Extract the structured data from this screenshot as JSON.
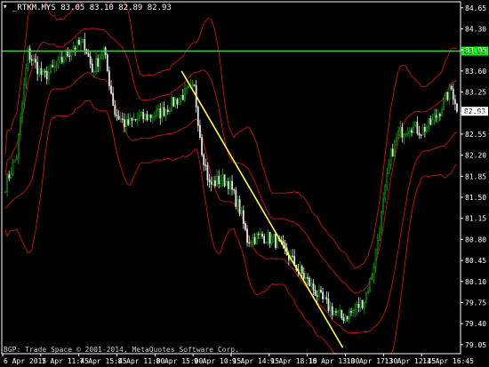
{
  "title": {
    "symbol": "_RTKM.MYS",
    "ohlc": "83.05 83.10 82.89 82.93"
  },
  "copyright": "BGP: Trade Space © 2001-2014, MetaQuotes Software Corp.",
  "colors": {
    "background": "#000000",
    "axis": "#ffffff",
    "bull": "#00b000",
    "bear": "#e8e8e8",
    "bands": "#d01010",
    "level_line": "#00ff00",
    "trend_line": "#ffff40",
    "grid": "#404040"
  },
  "chart_data": {
    "type": "candlestick",
    "ylim": [
      78.9,
      84.75
    ],
    "y_ticks": [
      "84.65",
      "84.30",
      "83.95",
      "83.60",
      "83.25",
      "82.90",
      "82.55",
      "82.20",
      "81.85",
      "81.50",
      "81.15",
      "80.80",
      "80.45",
      "80.10",
      "79.75",
      "79.40",
      "79.05"
    ],
    "x_ticks": [
      "6 Apr 2015",
      "7 Apr 11:45",
      "7 Apr 15:45",
      "8 Apr 11:00",
      "8 Apr 15:00",
      "9 Apr 10:15",
      "9 Apr 14:15",
      "9 Apr 18:15",
      "10 Apr 13:30",
      "10 Apr 17:30",
      "13 Apr 12:45",
      "13 Apr 16:45"
    ],
    "bar_count": 240,
    "level_line": {
      "value": 83.93,
      "label": "83.93"
    },
    "last_price": {
      "value": 82.93,
      "label": "82.93"
    },
    "trend_line": {
      "from": {
        "x": "9 Apr 10:15",
        "y": 83.6
      },
      "to": {
        "x": "10 Apr 17:30",
        "y": 79.0
      }
    },
    "close_path": [
      [
        0,
        81.7
      ],
      [
        6,
        82.2
      ],
      [
        12,
        83.9
      ],
      [
        20,
        83.5
      ],
      [
        28,
        83.7
      ],
      [
        36,
        84.0
      ],
      [
        42,
        84.05
      ],
      [
        46,
        83.6
      ],
      [
        52,
        83.95
      ],
      [
        58,
        82.9
      ],
      [
        64,
        82.7
      ],
      [
        70,
        82.8
      ],
      [
        76,
        82.85
      ],
      [
        82,
        82.9
      ],
      [
        88,
        83.05
      ],
      [
        94,
        83.2
      ],
      [
        100,
        83.3
      ],
      [
        104,
        82.3
      ],
      [
        108,
        81.7
      ],
      [
        114,
        81.8
      ],
      [
        118,
        81.75
      ],
      [
        124,
        81.3
      ],
      [
        128,
        80.8
      ],
      [
        136,
        80.85
      ],
      [
        142,
        80.8
      ],
      [
        148,
        80.6
      ],
      [
        154,
        80.35
      ],
      [
        160,
        80.1
      ],
      [
        166,
        79.85
      ],
      [
        172,
        79.65
      ],
      [
        178,
        79.5
      ],
      [
        184,
        79.6
      ],
      [
        190,
        79.8
      ],
      [
        194,
        80.2
      ],
      [
        198,
        81.0
      ],
      [
        204,
        82.2
      ],
      [
        208,
        82.55
      ],
      [
        214,
        82.7
      ],
      [
        220,
        82.6
      ],
      [
        226,
        82.75
      ],
      [
        230,
        82.95
      ],
      [
        234,
        83.2
      ],
      [
        236,
        83.3
      ],
      [
        240,
        82.93
      ]
    ],
    "band_width": 0.55,
    "band_period": 14,
    "outer_band_width": 1.25
  }
}
